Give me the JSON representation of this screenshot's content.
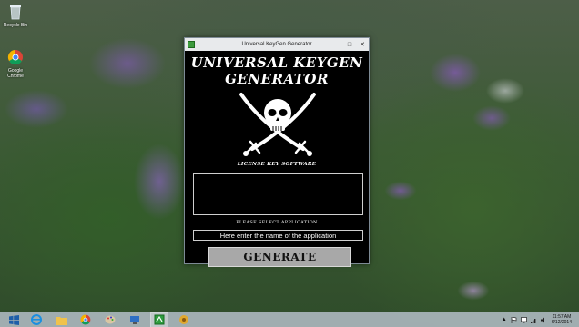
{
  "desktop": {
    "icons": [
      {
        "label": "Recycle Bin",
        "icon": "recycle-bin-icon"
      },
      {
        "label": "Google Chrome",
        "icon": "chrome-icon"
      }
    ]
  },
  "window": {
    "title": "Universal KeyGen Generator",
    "controls": {
      "minimize": "–",
      "maximize": "□",
      "close": "✕"
    },
    "heading_line1": "UNIVERSAL KEYGEN",
    "heading_line2": "GENERATOR",
    "subtitle": "LICENSE KEY SOFTWARE",
    "key_output": "",
    "select_label": "PLEASE SELECT APPLICATION",
    "app_input_value": "Here enter the name of the application",
    "generate_label": "GENERATE"
  },
  "taskbar": {
    "items": [
      "start-icon",
      "ie-icon",
      "file-explorer-icon",
      "chrome-icon",
      "paint-icon",
      "network-app-icon",
      "keygen-app-icon",
      "media-app-icon"
    ],
    "clock_time": "11:57 AM",
    "clock_date": "6/12/2014"
  }
}
